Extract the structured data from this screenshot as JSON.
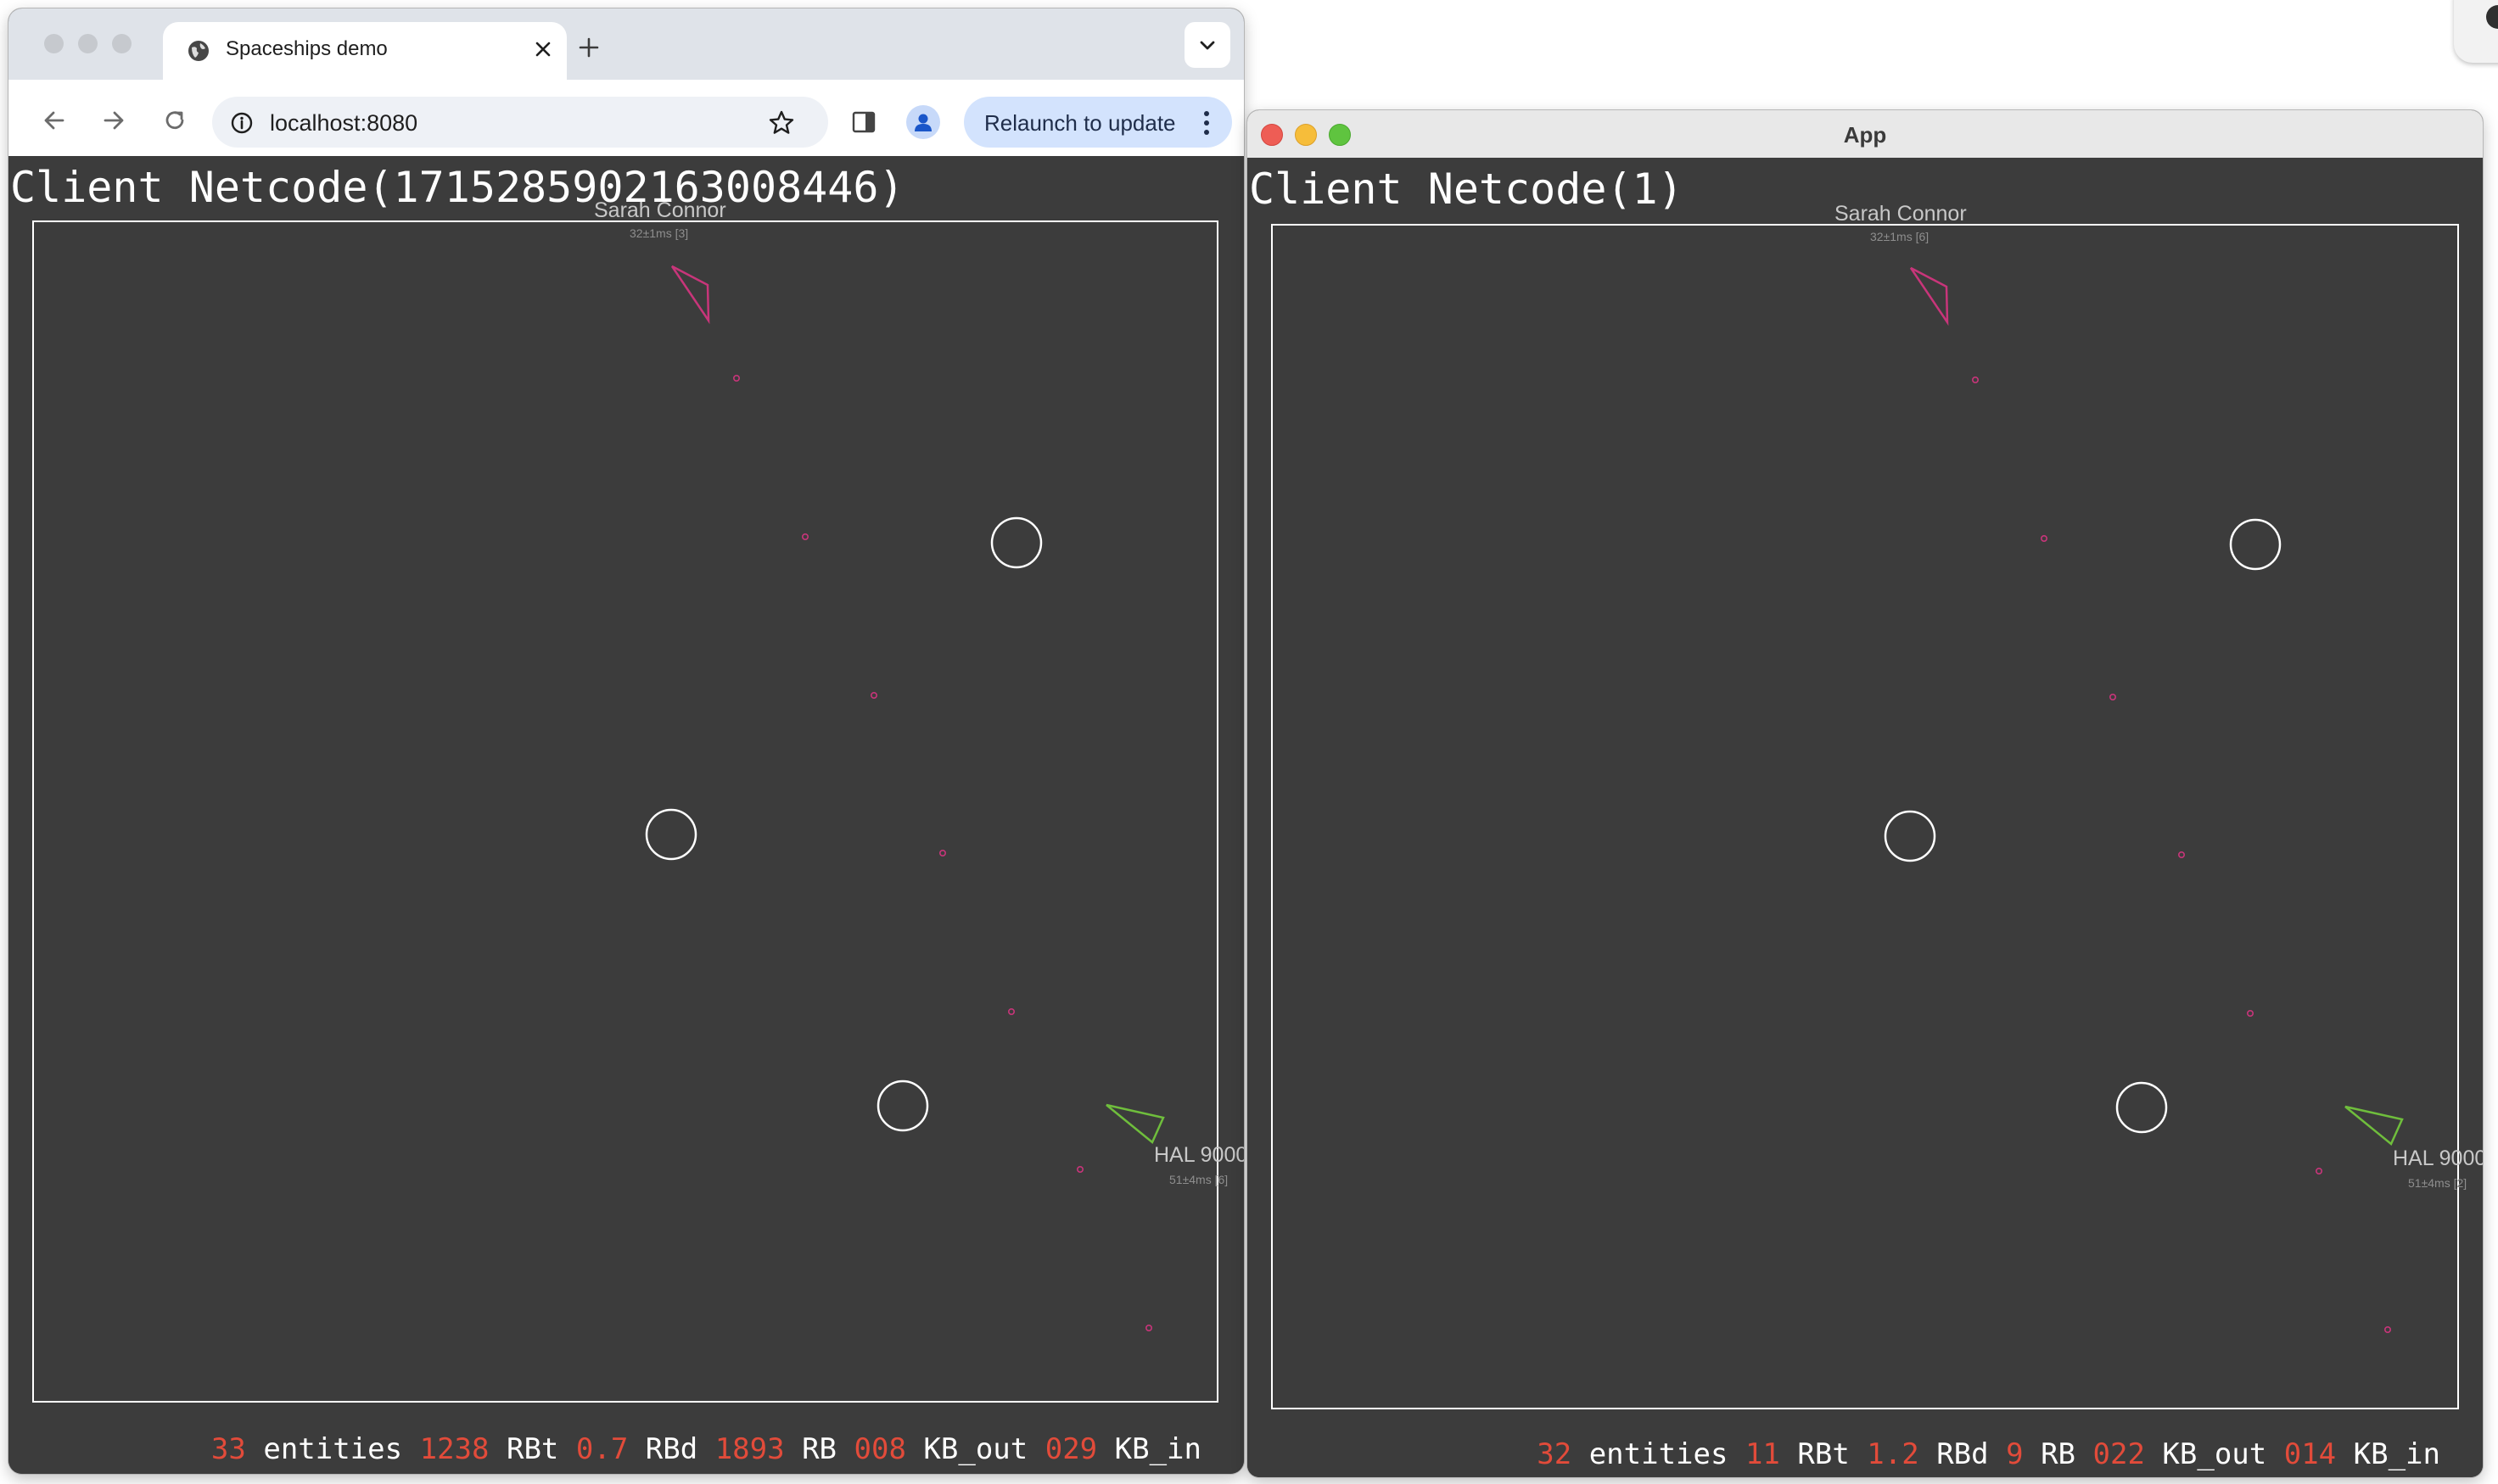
{
  "browser": {
    "tab_title": "Spaceships demo",
    "url": "localhost:8080",
    "relaunch_label": "Relaunch to update"
  },
  "app_window": {
    "title": "App"
  },
  "browser_client": {
    "title": "Client Netcode(1715285902163008446)",
    "players": [
      {
        "name": "Sarah Connor",
        "ping": "32±1ms [3]",
        "color": "#c8357a"
      },
      {
        "name": "HAL 9000",
        "ping": "51±4ms [6]",
        "color": "#6fbe3c"
      }
    ],
    "stats": [
      {
        "value": "33",
        "label": "entities"
      },
      {
        "value": "1238",
        "label": "RBt"
      },
      {
        "value": "0.7",
        "label": "RBd"
      },
      {
        "value": "1893",
        "label": "RB"
      },
      {
        "value": "008",
        "label": "KB_out"
      },
      {
        "value": "029",
        "label": "KB_in"
      }
    ]
  },
  "app_client": {
    "title": "Client Netcode(1)",
    "players": [
      {
        "name": "Sarah Connor",
        "ping": "32±1ms [6]",
        "color": "#c8357a"
      },
      {
        "name": "HAL 9000",
        "ping": "51±4ms [2]",
        "color": "#6fbe3c"
      }
    ],
    "stats": [
      {
        "value": "32",
        "label": "entities"
      },
      {
        "value": "11",
        "label": "RBt"
      },
      {
        "value": "1.2",
        "label": "RBd"
      },
      {
        "value": "9",
        "label": "RB"
      },
      {
        "value": "022",
        "label": "KB_out"
      },
      {
        "value": "014",
        "label": "KB_in"
      }
    ]
  },
  "colors": {
    "background": "#3c3c3c",
    "bullet": "#c8357a",
    "stat_number": "#e24b3a",
    "arena_border": "#ffffff",
    "relaunch_button": "#d3e3fd"
  }
}
